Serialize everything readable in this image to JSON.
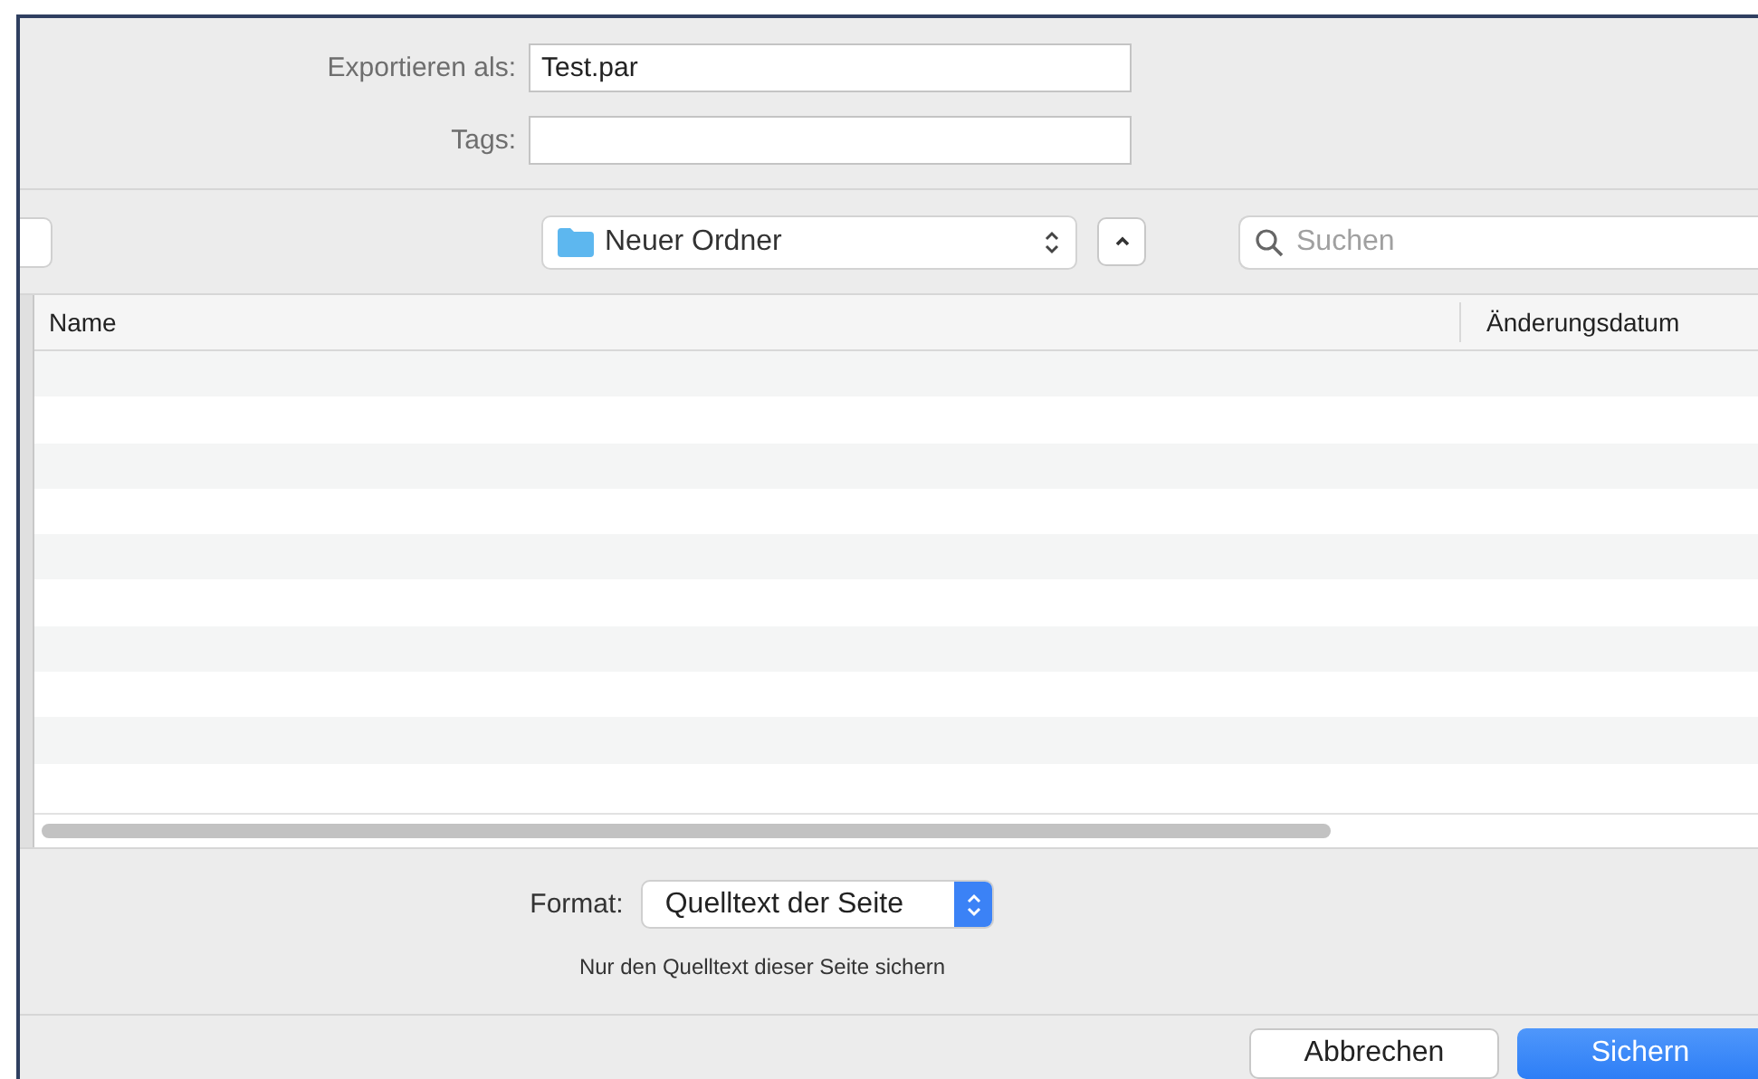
{
  "export_form": {
    "name_label": "Exportieren als:",
    "name_value": "Test.par",
    "tags_label": "Tags:"
  },
  "toolbar": {
    "location": "Neuer Ordner",
    "search_placeholder": "Suchen"
  },
  "file_list": {
    "columns": [
      "Name",
      "Änderungsdatum"
    ]
  },
  "format": {
    "label": "Format:",
    "value": "Quelltext der Seite",
    "hint": "Nur den Quelltext dieser Seite sichern"
  },
  "buttons": [
    {
      "label": "Abbrechen",
      "kind": "secondary"
    },
    {
      "label": "Sichern",
      "kind": "primary"
    }
  ]
}
